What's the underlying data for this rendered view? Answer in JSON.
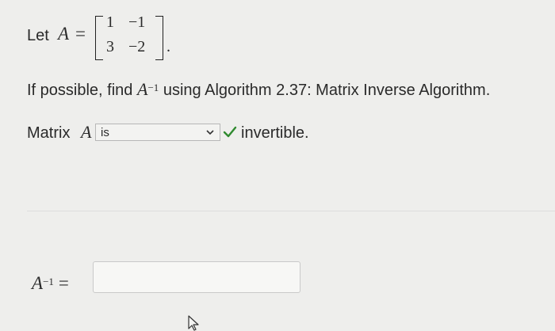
{
  "problem": {
    "let_label": "Let",
    "var_a": "A",
    "equals": "=",
    "matrix": [
      [
        "1",
        "−1"
      ],
      [
        "3",
        "−2"
      ]
    ],
    "period": "."
  },
  "instruction": {
    "prefix": "If possible, find",
    "var": "A",
    "superscript": "−1",
    "suffix": "using Algorithm 2.37: Matrix Inverse Algorithm."
  },
  "invertibility": {
    "label": "Matrix",
    "var": "A",
    "selected_value": "is",
    "status_icon": "check-icon",
    "status_color": "#2f8a2f",
    "tail": "invertible."
  },
  "answer": {
    "var": "A",
    "superscript": "−1",
    "equals": "=",
    "value": ""
  },
  "icons": {
    "dropdown": "chevron-down-icon",
    "pointer": "mouse-cursor-icon"
  }
}
